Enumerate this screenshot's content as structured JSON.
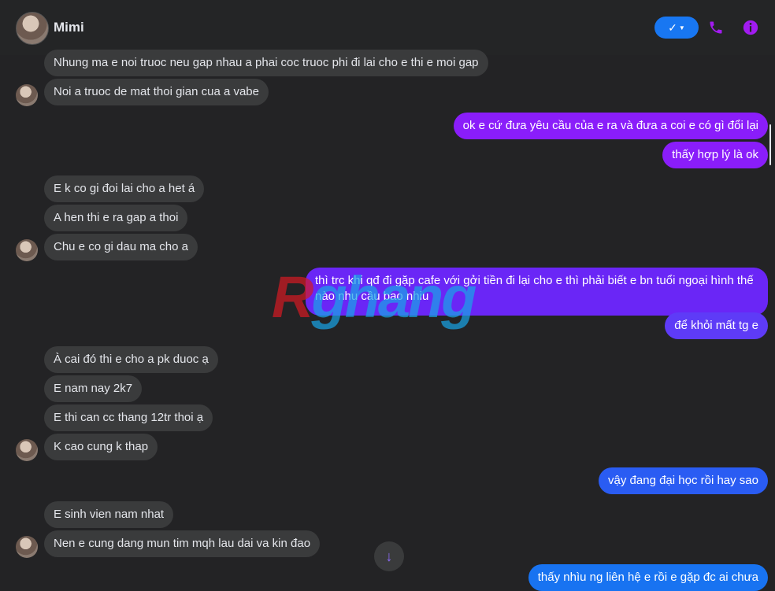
{
  "header": {
    "name": "Mimi",
    "icons": [
      "checkmark-dropdown-icon",
      "phone-icon",
      "info-icon"
    ]
  },
  "colors": {
    "incoming": "#3a3b3c",
    "outgoing_purple": "#8a1dfa",
    "outgoing_blue": "#1873f1",
    "accent": "#1877f2"
  },
  "messages": [
    {
      "dir": "in",
      "text": "Nhung ma e noi truoc neu gap nhau a phai coc truoc phi đi lai cho e thi e moi gap"
    },
    {
      "dir": "in",
      "text": "Noi a truoc de mat thoi gian cua a vabe"
    },
    {
      "dir": "out",
      "text": "ok e cứ đưa yêu cầu của e ra và đưa a coi e có gì đổi lại"
    },
    {
      "dir": "out",
      "text": "thấy hợp lý là ok"
    },
    {
      "dir": "in",
      "text": "E k co gi đoi lai cho a het á"
    },
    {
      "dir": "in",
      "text": "A hen thi e ra gap a thoi"
    },
    {
      "dir": "in",
      "text": "Chu e co gi dau ma cho a"
    },
    {
      "dir": "out",
      "text": "thì trc khi qđ đi gặp cafe với gởi tiền đi lại cho e thì phải biết e bn tuổi ngoại hình thế nào nhu cầu bao nhiu"
    },
    {
      "dir": "out",
      "text": "để khỏi mất tg e"
    },
    {
      "dir": "in",
      "text": "À cai đó thi e cho a pk duoc ạ"
    },
    {
      "dir": "in",
      "text": "E nam nay 2k7"
    },
    {
      "dir": "in",
      "text": "E thi can cc thang 12tr thoi ạ"
    },
    {
      "dir": "in",
      "text": "K cao cung k thap"
    },
    {
      "dir": "out",
      "text": "vậy đang đại học rồi hay sao"
    },
    {
      "dir": "in",
      "text": "E sinh vien nam nhat"
    },
    {
      "dir": "in",
      "text": "Nen e cung dang mun tim mqh lau dai va kin đao"
    },
    {
      "dir": "out",
      "text": "thấy nhìu ng liên hệ e rồi e gặp đc ai chưa"
    }
  ],
  "watermark": {
    "r": "R",
    "rest": "ghang"
  },
  "scroll_down_icon": "arrow-down-icon"
}
